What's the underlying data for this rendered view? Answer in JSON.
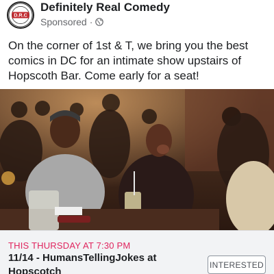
{
  "post": {
    "page_name": "Definitely Real Comedy",
    "sponsored_label": "Sponsored",
    "separator": "·",
    "logo_text": "D.R.C",
    "body_text": "On the corner of 1st & T, we bring you the best comics in DC for an intimate show upstairs of Hopscoth Bar. Come early for a seat!"
  },
  "event": {
    "when": "THIS THURSDAY AT 7:30 PM",
    "title": "11/14 - HumansTellingJokes at Hopscotch",
    "interested_label": "INTERESTED"
  },
  "icons": {
    "privacy": "globe-icon"
  },
  "colors": {
    "event_date": "#e0245e",
    "event_bar_bg": "#f2f3f5",
    "meta_text": "#65676b"
  }
}
